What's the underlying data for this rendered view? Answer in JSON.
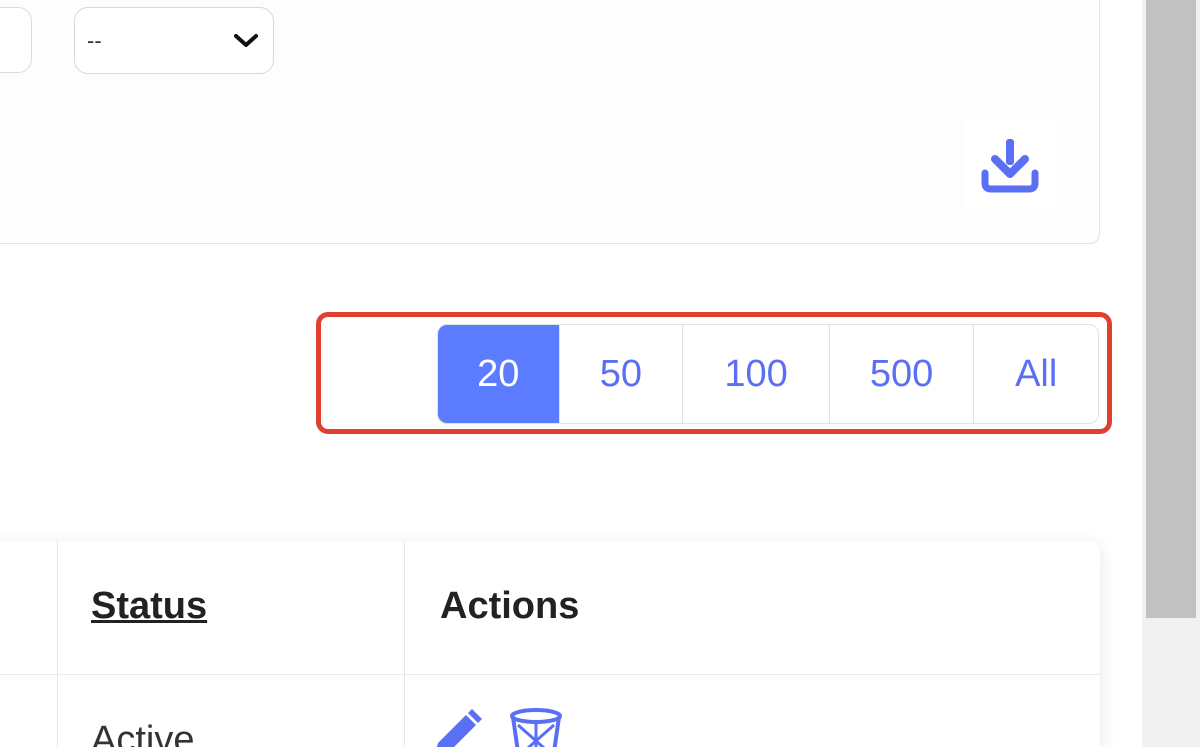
{
  "filters": {
    "select_value": "--"
  },
  "icons": {
    "chevron": "chevron-down-icon",
    "download": "download-icon",
    "edit": "pencil-icon",
    "delete": "trash-icon"
  },
  "pagination": {
    "options": [
      "20",
      "50",
      "100",
      "500",
      "All"
    ],
    "selected": "20"
  },
  "table": {
    "headers": {
      "status": "Status",
      "actions": "Actions"
    },
    "rows": [
      {
        "status": "Active"
      }
    ]
  },
  "colors": {
    "accent": "#5b7cff",
    "link": "#5b6ff5",
    "highlight": "#e0412f"
  }
}
